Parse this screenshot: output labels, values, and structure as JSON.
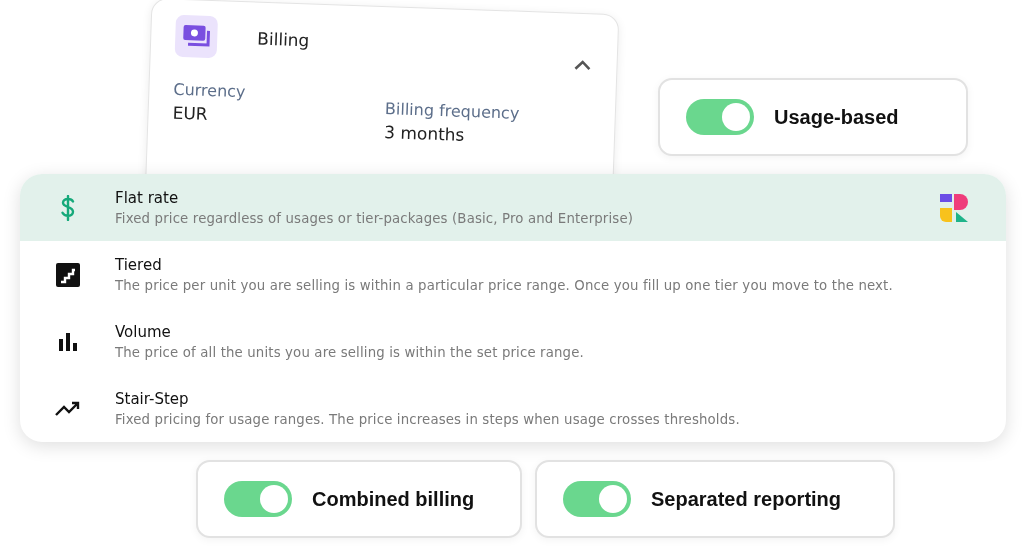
{
  "billing_card": {
    "title": "Billing",
    "expanded": true,
    "fields": [
      {
        "label": "Currency",
        "value": "EUR"
      },
      {
        "label": "Billing frequency",
        "value": "3 months"
      }
    ]
  },
  "usage_toggle": {
    "label": "Usage-based",
    "on": true
  },
  "pricing_models": [
    {
      "kind": "dollar",
      "title": "Flat rate",
      "description": "Fixed price regardless of usages or tier-packages (Basic, Pro and Enterprise)",
      "selected": true
    },
    {
      "kind": "stairs",
      "title": "Tiered",
      "description": "The price per unit you are selling is within a particular price range. Once you fill up one tier you move to the next.",
      "selected": false
    },
    {
      "kind": "bars",
      "title": "Volume",
      "description": "The price of all the units you are selling is within the set price range.",
      "selected": false
    },
    {
      "kind": "trend",
      "title": "Stair-Step",
      "description": "Fixed pricing for usage ranges. The price increases in steps when usage crosses thresholds.",
      "selected": false
    }
  ],
  "bottom_toggles": [
    {
      "label": "Combined billing",
      "on": true
    },
    {
      "label": "Separated reporting",
      "on": true
    }
  ]
}
